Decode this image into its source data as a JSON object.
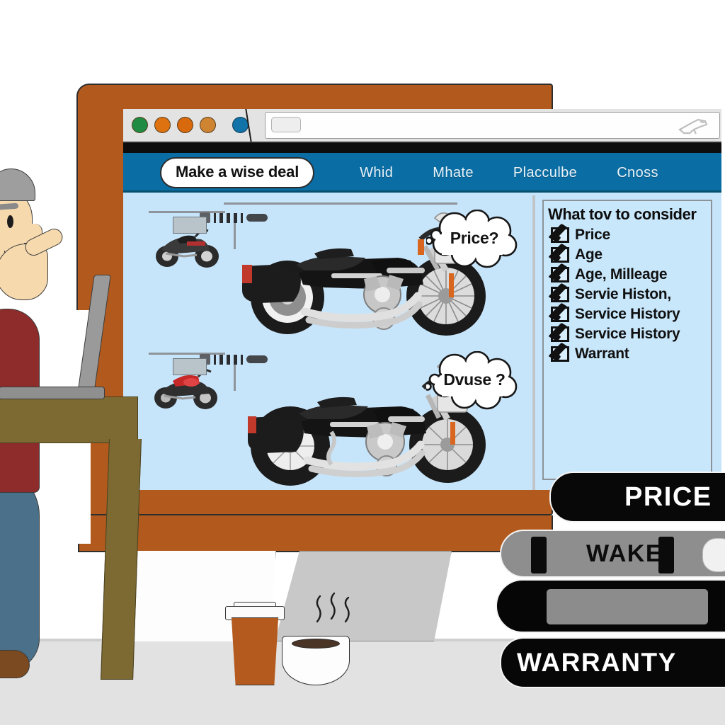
{
  "scene": {
    "description": "Cartoon illustration: a gray-haired man sits at a wooden desk with a laptop, looking at a large brown-framed monitor showing a motorcycle classifieds page, with a stack of labeled books and a coffee cup in the foreground.",
    "colors": {
      "monitor_frame": "#b25a1d",
      "nav_bar_blue": "#0a6da3",
      "content_blue": "#c7e5fa",
      "checklist_card": "#c9e7fb",
      "desk_wood": "#7d6a33",
      "shirt_sleeve": "#8e2b2b",
      "trousers": "#4a7189",
      "floor": "#e2e2e2",
      "cup_brown": "#b45a1e",
      "book_black": "#080808",
      "book_gray": "#8e8e8e"
    }
  },
  "browser": {
    "toolbar_dots": [
      {
        "name": "toolbar-dot-green",
        "color": "#1f8b43"
      },
      {
        "name": "toolbar-dot-orange-1",
        "color": "#de7210"
      },
      {
        "name": "toolbar-dot-orange-2",
        "color": "#d9690d"
      },
      {
        "name": "toolbar-dot-orange-3",
        "color": "#cf8432"
      },
      {
        "name": "toolbar-dot-blue",
        "color": "#1173a8"
      }
    ],
    "address_bar": {
      "value": "",
      "placeholder": "",
      "chip": ""
    },
    "toolbar_right_icon": "tool-wrench-icon"
  },
  "nav": {
    "cta_label": "Make a wise deal",
    "links": [
      {
        "label": "Whid"
      },
      {
        "label": "Mhate"
      },
      {
        "label": "Placculbe"
      },
      {
        "label": "Cnoss"
      }
    ]
  },
  "checklist": {
    "title": "What tov to consider",
    "items": [
      {
        "label": "Price",
        "checked": true
      },
      {
        "label": "Age",
        "checked": true
      },
      {
        "label": "Age, Milleage",
        "checked": true
      },
      {
        "label": "Servie Histon,",
        "checked": true
      },
      {
        "label": "Service History",
        "checked": true
      },
      {
        "label": "Service History",
        "checked": true
      },
      {
        "label": "Warrant",
        "checked": true
      }
    ]
  },
  "listings": [
    {
      "name": "listing-row-1",
      "thumbnail": "black-motorcycle-thumbnail",
      "hero": "black-cruiser-motorcycle",
      "meta_glyphs": "illegible-spec-glyphs",
      "bubble": "Price?"
    },
    {
      "name": "listing-row-2",
      "thumbnail": "red-motorcycle-thumbnail",
      "hero": "black-cruiser-motorcycle",
      "meta_glyphs": "illegible-spec-glyphs",
      "bubble": "Dvuse ?"
    }
  ],
  "bubbles": [
    {
      "text": "Price?"
    },
    {
      "text": "Dvuse ?"
    }
  ],
  "books": [
    {
      "label": "PRICE",
      "style": "black"
    },
    {
      "label": "WAKE",
      "style": "gray"
    },
    {
      "label": "",
      "style": "black-with-gray-panel"
    },
    {
      "label": "WARRANTY",
      "style": "black"
    }
  ],
  "desk_items": {
    "coffee_cup": "takeaway-coffee-cup",
    "bowl": "steaming-coffee-bowl",
    "laptop": "open-laptop"
  },
  "person": {
    "pose": "hand-on-chin-thinking",
    "hair_color": "#9e9e9e",
    "sleeve_color": "#8e2b2b"
  }
}
